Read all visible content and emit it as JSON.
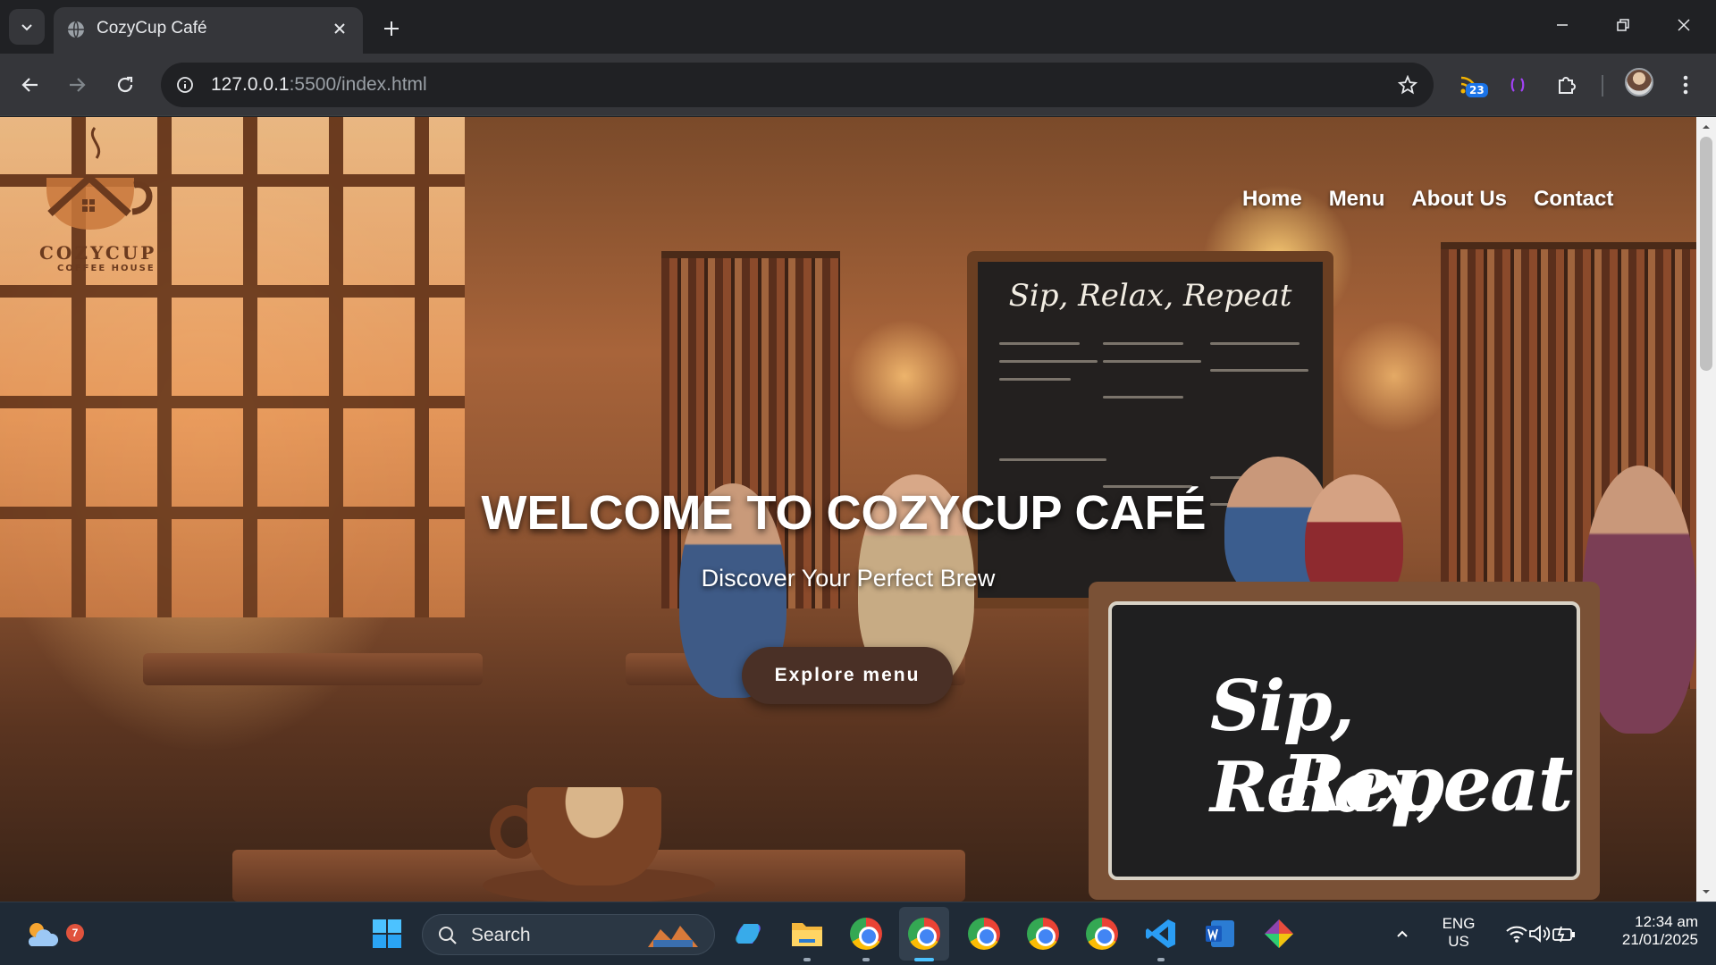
{
  "browser": {
    "tab": {
      "title": "CozyCup Café"
    },
    "address": {
      "host": "127.0.0.1",
      "path": ":5500/index.html"
    },
    "extension_badge": "23"
  },
  "site": {
    "logo": {
      "word": "COZYCUP",
      "sub": "COFFEE HOUSE"
    },
    "nav": [
      "Home",
      "Menu",
      "About Us",
      "Contact"
    ],
    "hero": {
      "title": "WELCOME TO COZYCUP CAFÉ",
      "subtitle": "Discover Your Perfect Brew",
      "button": "Explore menu"
    },
    "artwork": {
      "chalkboard_title": "Sip, Relax, Repeat",
      "sign_line1": "Sip, Relax,",
      "sign_line2": "Repeat"
    }
  },
  "taskbar": {
    "weather_badge": "7",
    "search_label": "Search",
    "language": {
      "line1": "ENG",
      "line2": "US"
    },
    "clock": {
      "time": "12:34 am",
      "date": "21/01/2025"
    }
  },
  "colors": {
    "chrome_bg": "#202124",
    "toolbar_bg": "#35363a",
    "button_bg": "#4a3026",
    "taskbar_bg": "#1f2a36"
  }
}
